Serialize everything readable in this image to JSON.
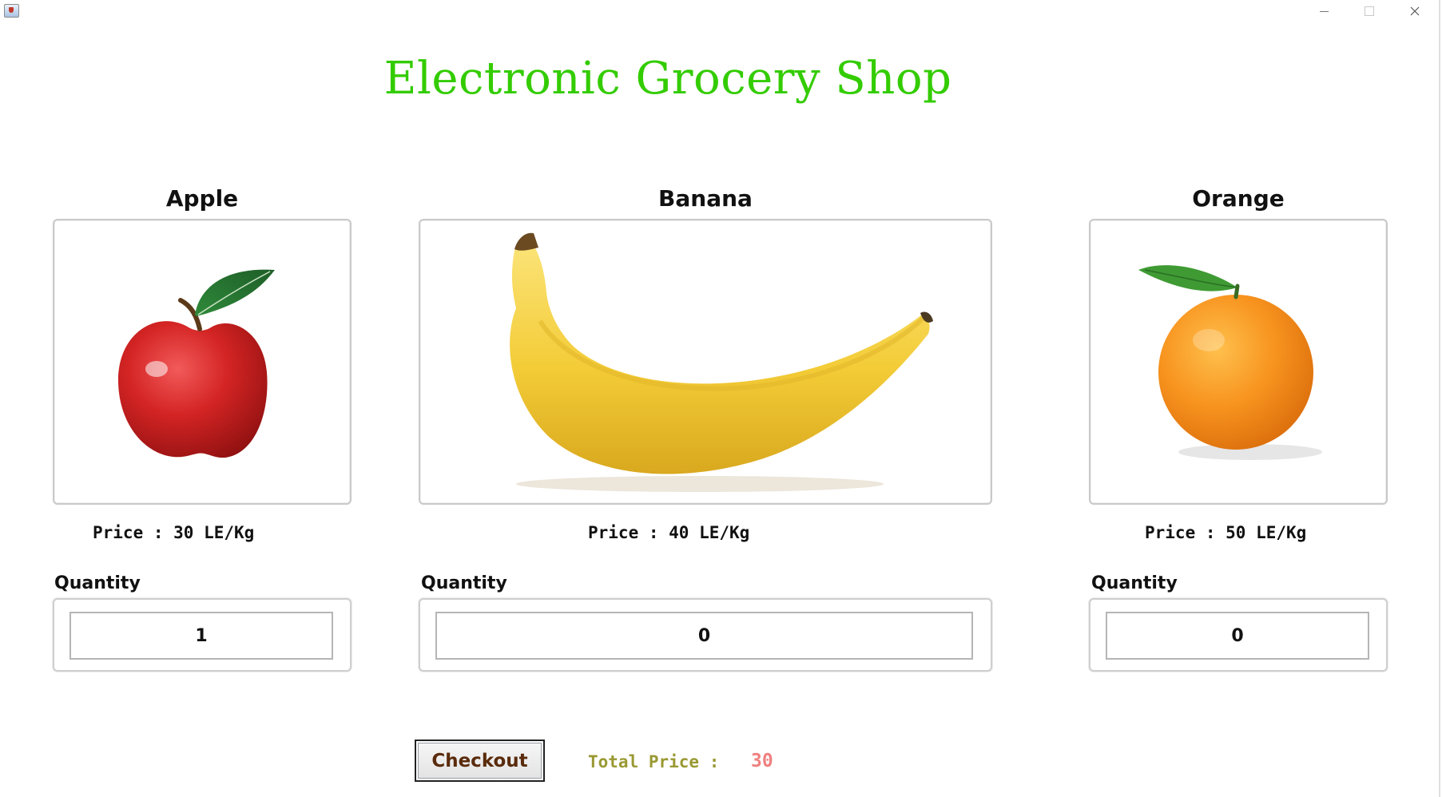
{
  "window": {
    "minimize_glyph": "—",
    "maximize_glyph": "□",
    "close_glyph": "✕",
    "app_icon": "java-cup-icon"
  },
  "shop": {
    "title": "Electronic Grocery Shop",
    "title_color": "#33cc00"
  },
  "products": [
    {
      "name": "Apple",
      "image_icon": "apple-icon",
      "price": "Price : 30 LE/Kg",
      "quantity_label": "Quantity",
      "quantity": "1"
    },
    {
      "name": "Banana",
      "image_icon": "banana-icon",
      "price": "Price : 40 LE/Kg",
      "quantity_label": "Quantity",
      "quantity": "0"
    },
    {
      "name": "Orange",
      "image_icon": "orange-icon",
      "price": "Price : 50 LE/Kg",
      "quantity_label": "Quantity",
      "quantity": "0"
    }
  ],
  "checkout": {
    "button_label": "Checkout",
    "total_label": "Total Price :",
    "total_value": "30",
    "total_label_color": "#999933",
    "total_value_color": "#f08080"
  }
}
